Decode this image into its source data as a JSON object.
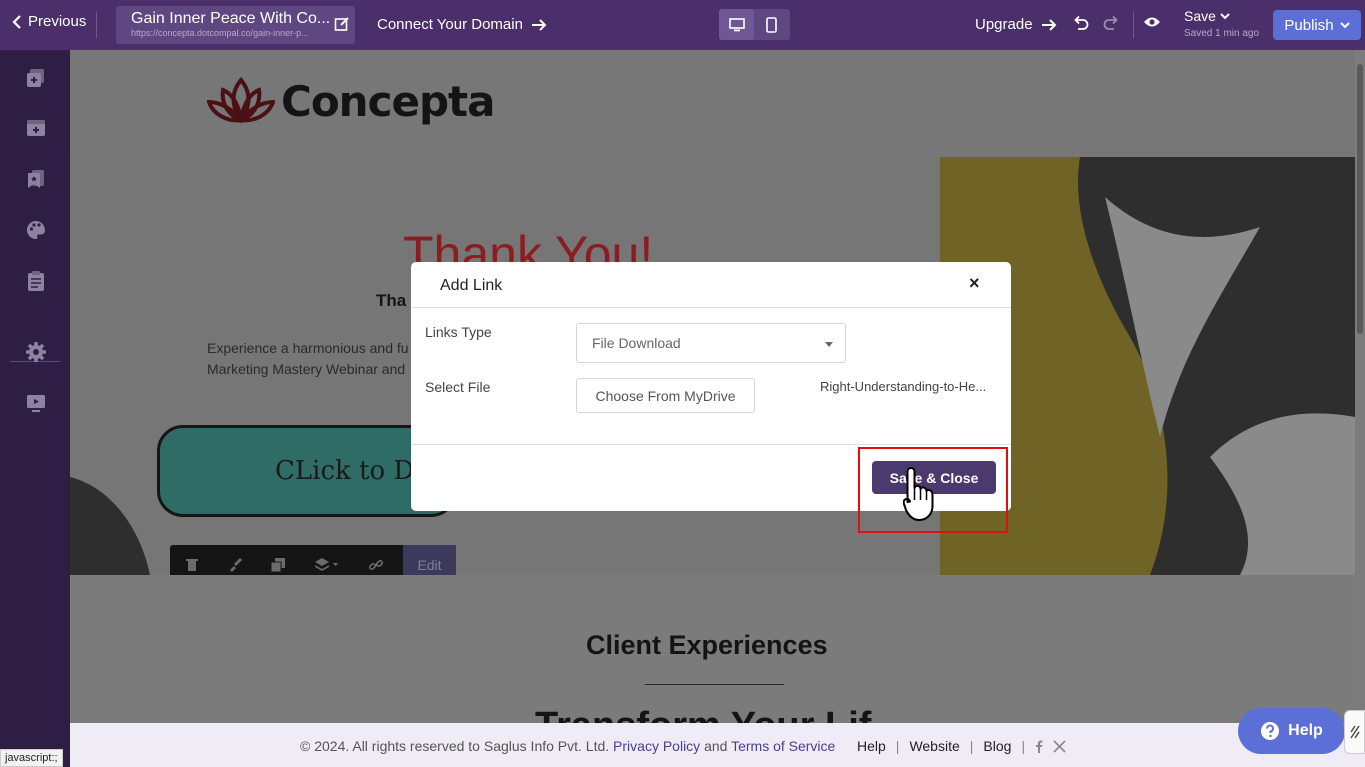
{
  "topbar": {
    "previous_label": "Previous",
    "page_title": "Gain Inner Peace With Co...",
    "page_url": "https://concepta.dotcompal.co/gain-inner-p...",
    "connect_domain_label": "Connect Your Domain",
    "upgrade_label": "Upgrade",
    "save_label": "Save",
    "saved_status": "Saved 1 min ago",
    "publish_label": "Publish"
  },
  "page": {
    "logo_text": "Concepta",
    "thank_you": "Thank You!",
    "thank_sub": "Tha",
    "experience_text": "Experience a harmonious and fu Marketing Mastery Webinar and",
    "cta_text": "CLick to D",
    "edit_label": "Edit",
    "client_heading": "Client Experiences",
    "transform_heading": "Transform Your Lif"
  },
  "modal": {
    "title": "Add Link",
    "close_glyph": "×",
    "links_type_label": "Links Type",
    "links_type_value": "File Download",
    "select_file_label": "Select File",
    "choose_button": "Choose From MyDrive",
    "file_name": "Right-Understanding-to-He...",
    "save_close_button": "Save & Close"
  },
  "footer": {
    "copyright": "©  2024. All rights reserved to Saglus Info Pvt. Ltd.",
    "privacy": "Privacy Policy",
    "and": "and",
    "terms": "Terms of Service",
    "help": "Help",
    "website": "Website",
    "blog": "Blog",
    "pipe": "|"
  },
  "status_bar": "javascript:;",
  "help_button": "Help",
  "colors": {
    "topbar": "#4a2f6b",
    "sidebar": "#2e1e44",
    "publish": "#5b6fd6",
    "save_close": "#4a3a6e",
    "highlight": "#e01010"
  }
}
